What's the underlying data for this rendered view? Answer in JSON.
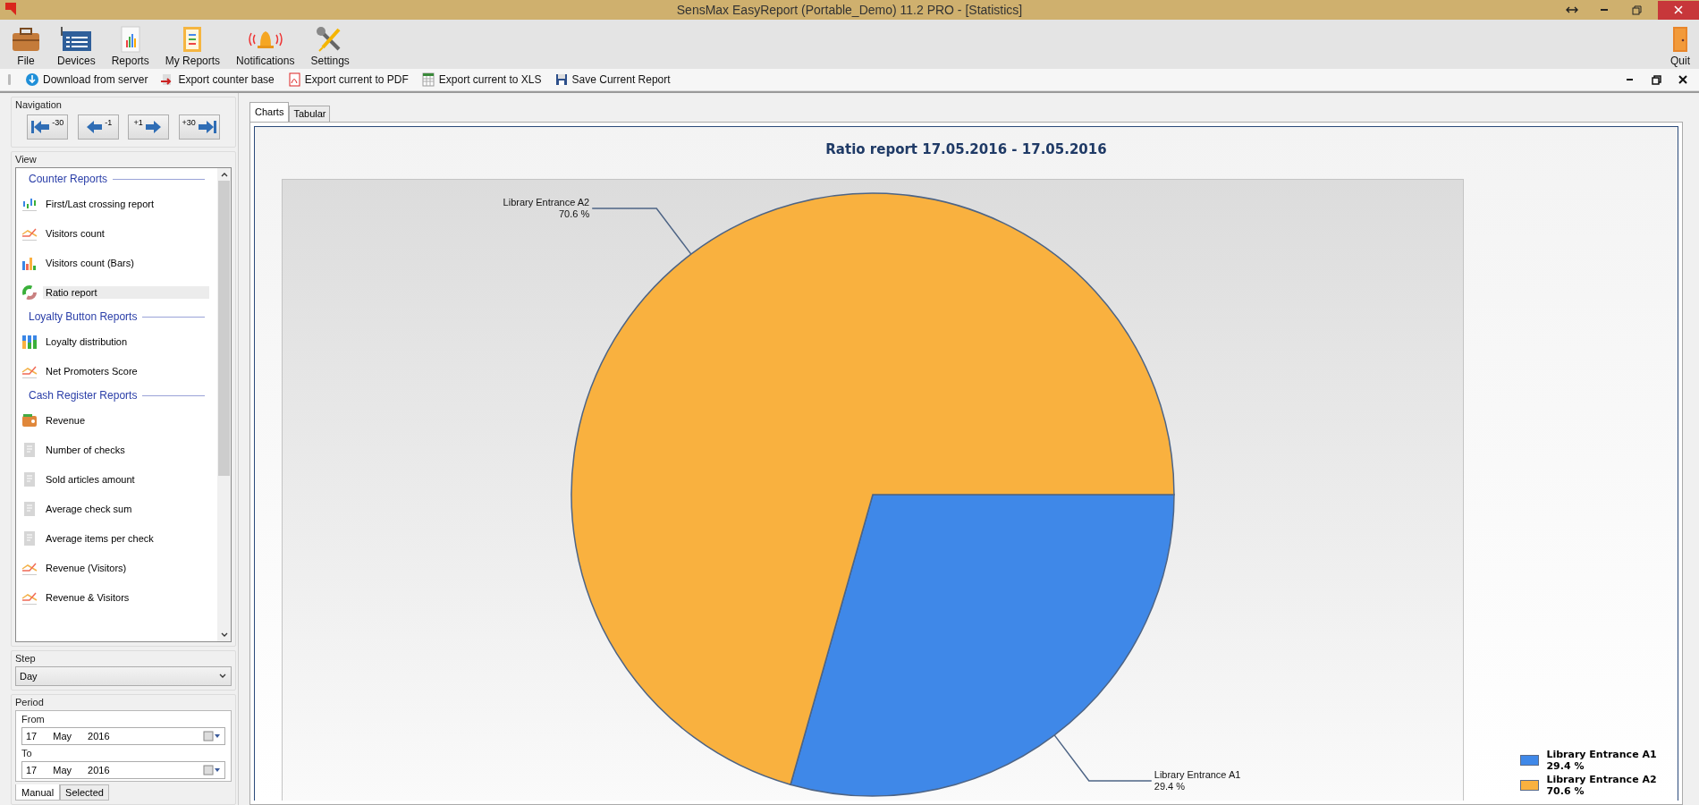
{
  "window": {
    "title": "SensMax EasyReport (Portable_Demo) 11.2 PRO - [Statistics]"
  },
  "ribbon": {
    "items": [
      {
        "label": "File",
        "kind": "file"
      },
      {
        "label": "Devices",
        "kind": "devices"
      },
      {
        "label": "Reports",
        "kind": "reports"
      },
      {
        "label": "My Reports",
        "kind": "myreports"
      },
      {
        "label": "Notifications",
        "kind": "bell"
      },
      {
        "label": "Settings",
        "kind": "settings"
      }
    ],
    "quit": "Quit"
  },
  "toolbar": {
    "items": [
      {
        "label": "Download from server",
        "kind": "download"
      },
      {
        "label": "Export counter base",
        "kind": "export"
      },
      {
        "label": "Export current to PDF",
        "kind": "pdf"
      },
      {
        "label": "Export current to XLS",
        "kind": "xls"
      },
      {
        "label": "Save Current Report",
        "kind": "save"
      }
    ]
  },
  "navigation": {
    "title": "Navigation",
    "buttons": [
      {
        "label": "-30",
        "kind": "first"
      },
      {
        "label": "-1",
        "kind": "prev"
      },
      {
        "label": "+1",
        "kind": "next"
      },
      {
        "label": "+30",
        "kind": "last"
      }
    ]
  },
  "view": {
    "title": "View",
    "groups": [
      {
        "title": "Counter Reports",
        "items": [
          {
            "label": "First/Last crossing report",
            "kind": "crossing",
            "selected": false
          },
          {
            "label": "Visitors count",
            "kind": "line",
            "selected": false
          },
          {
            "label": "Visitors count (Bars)",
            "kind": "bars",
            "selected": false
          },
          {
            "label": "Ratio report",
            "kind": "ratio",
            "selected": true
          }
        ]
      },
      {
        "title": "Loyalty Button Reports",
        "items": [
          {
            "label": "Loyalty distribution",
            "kind": "loyalty",
            "selected": false
          },
          {
            "label": "Net Promoters Score",
            "kind": "line",
            "selected": false
          }
        ]
      },
      {
        "title": "Cash Register Reports",
        "items": [
          {
            "label": "Revenue",
            "kind": "wallet",
            "selected": false
          },
          {
            "label": "Number of checks",
            "kind": "receipt",
            "selected": false
          },
          {
            "label": "Sold articles amount",
            "kind": "receipt",
            "selected": false
          },
          {
            "label": "Average check sum",
            "kind": "receipt",
            "selected": false
          },
          {
            "label": "Average items per check",
            "kind": "receipt",
            "selected": false
          },
          {
            "label": "Revenue (Visitors)",
            "kind": "line",
            "selected": false
          },
          {
            "label": "Revenue & Visitors",
            "kind": "line",
            "selected": false
          }
        ]
      }
    ]
  },
  "step": {
    "title": "Step",
    "value": "Day"
  },
  "period": {
    "title": "Period",
    "from_label": "From",
    "from": {
      "day": "17",
      "month": "May",
      "year": "2016"
    },
    "to_label": "To",
    "to": {
      "day": "17",
      "month": "May",
      "year": "2016"
    },
    "tabs": [
      {
        "label": "Manual",
        "selected": true
      },
      {
        "label": "Selected",
        "selected": false
      }
    ]
  },
  "tabs": [
    {
      "label": "Charts",
      "selected": true
    },
    {
      "label": "Tabular",
      "selected": false
    }
  ],
  "chart": {
    "chart_data": {
      "type": "pie",
      "title": "Ratio report 17.05.2016 - 17.05.2016",
      "categories": [
        "Library Entrance A1",
        "Library Entrance A2"
      ],
      "values": [
        29.4,
        70.6
      ]
    },
    "labels": [
      {
        "value": "29.4 %"
      },
      {
        "value": "70.6 %"
      }
    ],
    "legend": [
      {
        "name": "Library Entrance A1",
        "value": "29.4 %",
        "color": "#3f88e8"
      },
      {
        "name": "Library Entrance A2",
        "value": "70.6 %",
        "color": "#f9b13f"
      }
    ]
  }
}
